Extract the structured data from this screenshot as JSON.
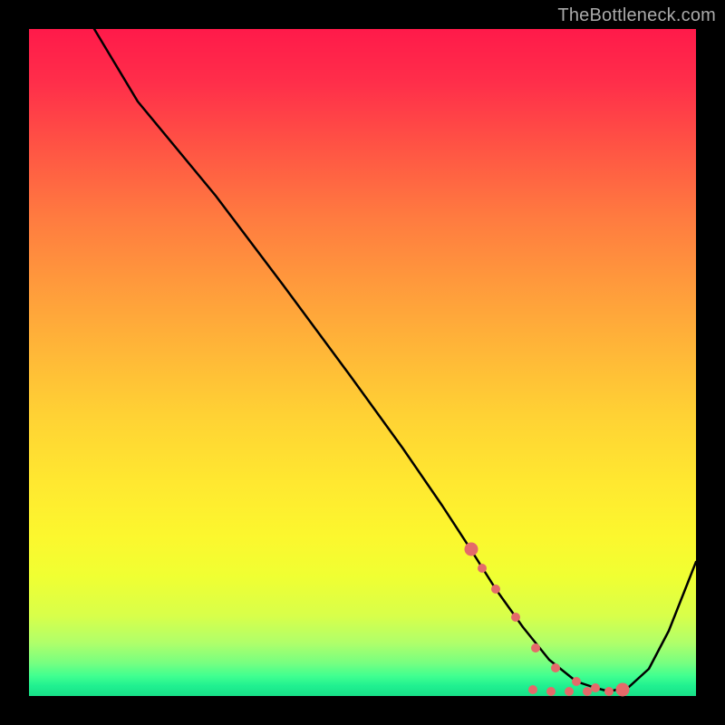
{
  "watermark": "TheBottleneck.com",
  "chart_data": {
    "type": "line",
    "title": "",
    "xlabel": "",
    "ylabel": "",
    "xlim": [
      0,
      100
    ],
    "ylim": [
      0,
      100
    ],
    "series": [
      {
        "name": "curve",
        "x": [
          10,
          18,
          28,
          38,
          48,
          56,
          62,
          66,
          70,
          74,
          78,
          82,
          84,
          87,
          90,
          93,
          96,
          100
        ],
        "y": [
          100,
          89,
          75,
          62,
          48,
          37,
          28,
          22,
          16,
          10,
          5,
          2,
          1,
          0.5,
          1,
          4,
          10,
          20
        ]
      }
    ],
    "highlight_points": {
      "name": "optimal-zone",
      "x": [
        66,
        68,
        70,
        73,
        76,
        79,
        82,
        85,
        87,
        89
      ],
      "y": [
        22,
        18,
        16,
        12,
        7,
        4,
        2,
        1,
        0.5,
        1
      ]
    }
  }
}
